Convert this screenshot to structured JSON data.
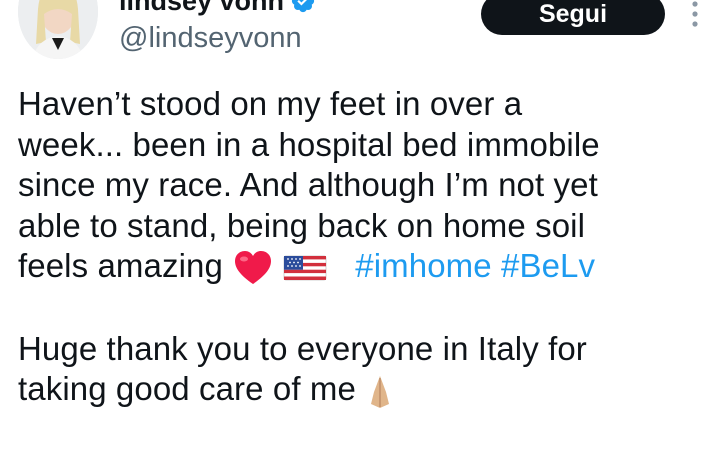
{
  "author": {
    "display_name": "lindsey vonn",
    "handle": "@lindseyvonn",
    "verified": true,
    "avatar_icon": "user-avatar"
  },
  "actions": {
    "follow_label": "Segui",
    "more_icon": "more-vertical-icon"
  },
  "tweet": {
    "line1": "Haven’t stood on my feet in over a",
    "line2": "week... been in a hospital bed immobile",
    "line3": "since my race. And although I’m not yet",
    "line4": "able to stand, being back on home soil",
    "line5_text": "feels amazing",
    "emoji_heart": "heart-emoji",
    "emoji_flag": "us-flag-emoji",
    "hashtag1": "#imhome",
    "hashtag2": "#BeLv",
    "line6": "Huge thank you to everyone in Italy for",
    "line7_text": "taking good care of me",
    "emoji_pray": "folded-hands-emoji"
  },
  "colors": {
    "text": "#0f1419",
    "secondary": "#536471",
    "link": "#1d9bf0",
    "verified": "#1d9bf0",
    "follow_bg": "#0f1419"
  }
}
